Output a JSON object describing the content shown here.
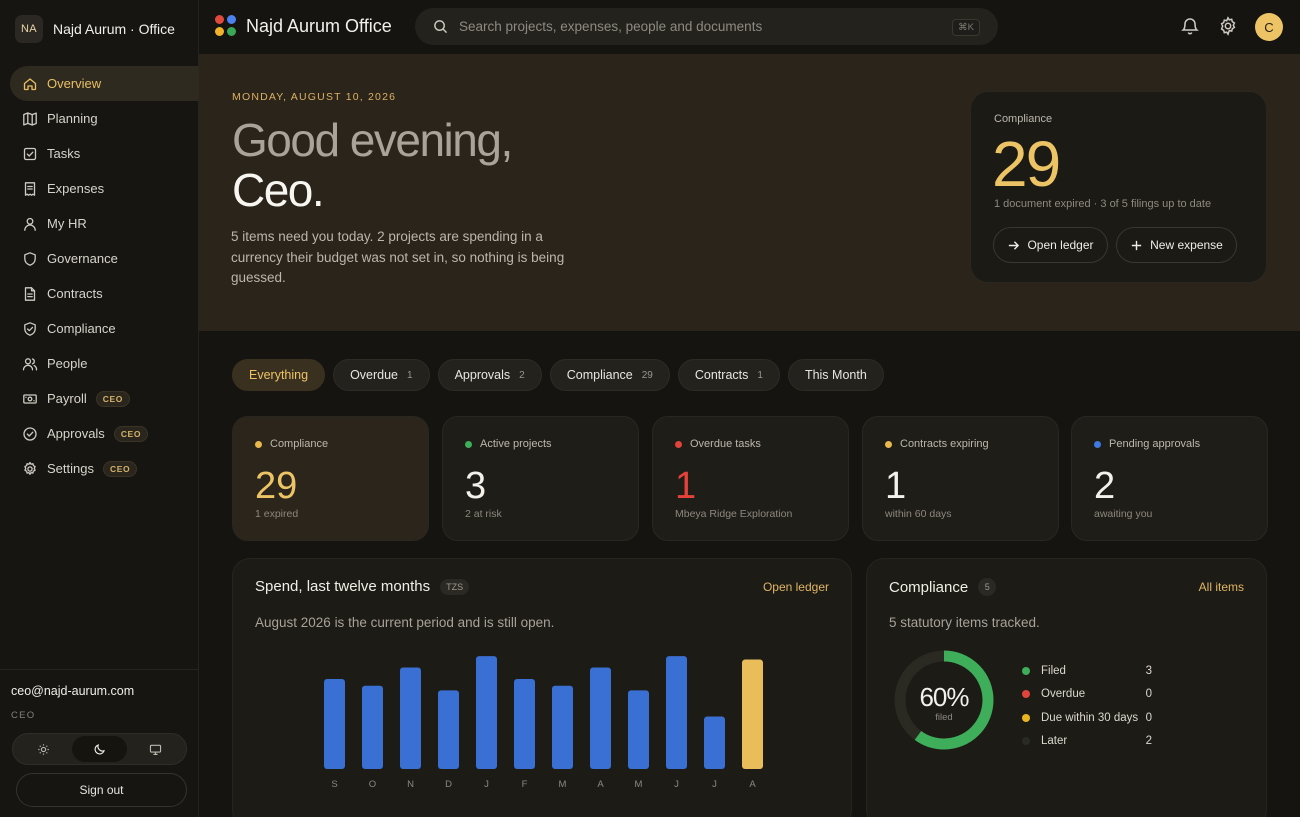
{
  "brand": {
    "initials": "NA",
    "name": "Najd Aurum · Office"
  },
  "app": {
    "title": "Najd Aurum Office"
  },
  "search": {
    "placeholder": "Search projects, expenses, people and documents",
    "shortcut": "⌘K"
  },
  "user": {
    "avatar_initial": "C",
    "email": "ceo@najd-aurum.com",
    "role": "CEO"
  },
  "nav": [
    {
      "label": "Overview",
      "icon": "home-icon",
      "active": true
    },
    {
      "label": "Planning",
      "icon": "map-icon"
    },
    {
      "label": "Tasks",
      "icon": "checkbox-icon"
    },
    {
      "label": "Expenses",
      "icon": "receipt-icon"
    },
    {
      "label": "My HR",
      "icon": "person-icon"
    },
    {
      "label": "Governance",
      "icon": "shield-icon"
    },
    {
      "label": "Contracts",
      "icon": "document-icon"
    },
    {
      "label": "Compliance",
      "icon": "shield-check-icon"
    },
    {
      "label": "People",
      "icon": "people-icon"
    },
    {
      "label": "Payroll",
      "icon": "cash-icon",
      "badge": "CEO"
    },
    {
      "label": "Approvals",
      "icon": "check-circle-icon",
      "badge": "CEO"
    },
    {
      "label": "Settings",
      "icon": "gear-icon",
      "badge": "CEO"
    }
  ],
  "sidebar_footer": {
    "sign_out": "Sign out",
    "theme_options": [
      "sun-icon",
      "moon-icon",
      "monitor-icon"
    ],
    "theme_selected": "moon-icon"
  },
  "hero": {
    "date": "MONDAY, AUGUST 10, 2026",
    "greeting": "Good evening,",
    "name": "Ceo.",
    "summary": "5 items need you today. 2 projects are spending in a currency their budget was not set in, so nothing is being guessed."
  },
  "hero_card": {
    "label": "Compliance",
    "value": "29",
    "subtitle": "1 document expired · 3 of 5 filings up to date",
    "open_ledger": "Open ledger",
    "new_expense": "New expense"
  },
  "filters": [
    {
      "label": "Everything",
      "active": true
    },
    {
      "label": "Overdue",
      "count": "1"
    },
    {
      "label": "Approvals",
      "count": "2"
    },
    {
      "label": "Compliance",
      "count": "29"
    },
    {
      "label": "Contracts",
      "count": "1"
    },
    {
      "label": "This Month"
    }
  ],
  "stats": [
    {
      "label": "Compliance",
      "value": "29",
      "sub": "1 expired",
      "dot": "#e8b84f",
      "value_color": "#ecc466",
      "highlight": true
    },
    {
      "label": "Active projects",
      "value": "3",
      "sub": "2 at risk",
      "dot": "#3fae5a",
      "value_color": "#f4f1ea"
    },
    {
      "label": "Overdue tasks",
      "value": "1",
      "sub": "Mbeya Ridge Exploration",
      "dot": "#e0443c",
      "value_color": "#e5423a"
    },
    {
      "label": "Contracts expiring",
      "value": "1",
      "sub": "within 60 days",
      "dot": "#e8b84f",
      "value_color": "#f4f1ea"
    },
    {
      "label": "Pending approvals",
      "value": "2",
      "sub": "awaiting you",
      "dot": "#3d7be0",
      "value_color": "#f4f1ea"
    }
  ],
  "spend_panel": {
    "title": "Spend, last twelve months",
    "currency": "TZS",
    "link": "Open ledger",
    "description": "August 2026 is the current period and is still open."
  },
  "chart_data": {
    "type": "bar",
    "categories": [
      "S",
      "O",
      "N",
      "D",
      "J",
      "F",
      "M",
      "A",
      "M",
      "J",
      "J",
      "A"
    ],
    "values": [
      0.79,
      0.73,
      0.89,
      0.69,
      0.99,
      0.79,
      0.73,
      0.89,
      0.69,
      0.99,
      0.46,
      0.96
    ],
    "current_index": 11,
    "bar_color": "#3a6fd3",
    "current_color": "#e8bd5a",
    "title": "Spend, last twelve months"
  },
  "compliance_panel": {
    "title": "Compliance",
    "count": "5",
    "link": "All items",
    "description": "5 statutory items tracked.",
    "percent": "60%",
    "percent_value": 0.6,
    "percent_caption": "filed",
    "legend": [
      {
        "label": "Filed",
        "value": "3",
        "color": "#3fae5a"
      },
      {
        "label": "Overdue",
        "value": "0",
        "color": "#e0443c"
      },
      {
        "label": "Due within 30 days",
        "value": "0",
        "color": "#e8b521"
      },
      {
        "label": "Later",
        "value": "2",
        "color": "#2a2a24"
      }
    ]
  }
}
